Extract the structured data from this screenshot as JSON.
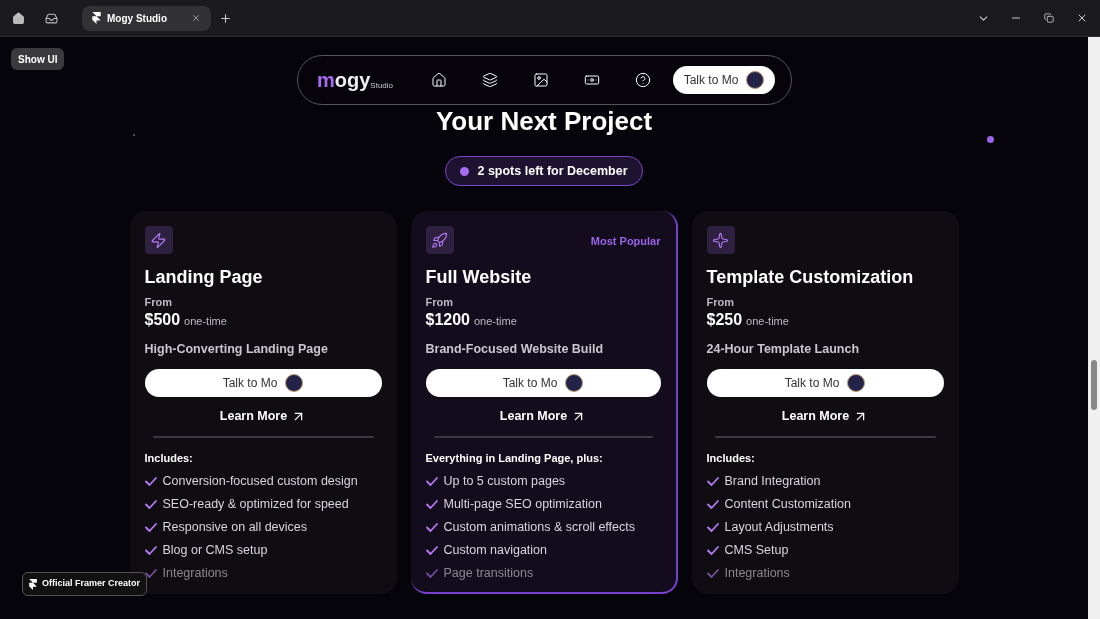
{
  "browser": {
    "tabs": [
      {
        "title": "Mogy Studio",
        "selected": true
      }
    ]
  },
  "show_ui": "Show UI",
  "nav": {
    "logo": "mogy",
    "logo_sub": "Studio",
    "cta": "Talk to Mo"
  },
  "heading": "Your Next Project",
  "availability": "2 spots left for December",
  "plans": [
    {
      "kind": "bolt",
      "featured": false,
      "title": "Landing Page",
      "from": "From",
      "price": "$500",
      "period": "one-time",
      "subtitle": "High-Converting Landing Page",
      "cta": "Talk to Mo",
      "link": "Learn More",
      "includes_title": "Includes:",
      "items": [
        {
          "text": "Conversion-focused custom design",
          "faded": false
        },
        {
          "text": "SEO-ready & optimized for speed",
          "faded": false
        },
        {
          "text": "Responsive on all devices",
          "faded": false
        },
        {
          "text": "Blog or CMS setup",
          "faded": false
        },
        {
          "text": "Integrations",
          "faded": true
        }
      ]
    },
    {
      "kind": "rocket",
      "featured": true,
      "badge": "Most Popular",
      "title": "Full Website",
      "from": "From",
      "price": "$1200",
      "period": "one-time",
      "subtitle": "Brand-Focused Website Build",
      "cta": "Talk to Mo",
      "link": "Learn More",
      "includes_title": "Everything in Landing Page, plus:",
      "items": [
        {
          "text": "Up to 5 custom pages",
          "faded": false
        },
        {
          "text": "Multi-page SEO optimization",
          "faded": false
        },
        {
          "text": "Custom animations & scroll effects",
          "faded": false
        },
        {
          "text": "Custom navigation",
          "faded": false
        },
        {
          "text": "Page transitions",
          "faded": true
        }
      ]
    },
    {
      "kind": "sparkle",
      "featured": false,
      "title": "Template Customization",
      "from": "From",
      "price": "$250",
      "period": "one-time",
      "subtitle": "24-Hour Template Launch",
      "cta": "Talk to Mo",
      "link": "Learn More",
      "includes_title": "Includes:",
      "items": [
        {
          "text": "Brand Integration",
          "faded": false
        },
        {
          "text": "Content Customization",
          "faded": false
        },
        {
          "text": "Layout Adjustments",
          "faded": false
        },
        {
          "text": "CMS Setup",
          "faded": false
        },
        {
          "text": "Integrations",
          "faded": true
        }
      ]
    }
  ],
  "creator_badge": "Official Framer Creator"
}
